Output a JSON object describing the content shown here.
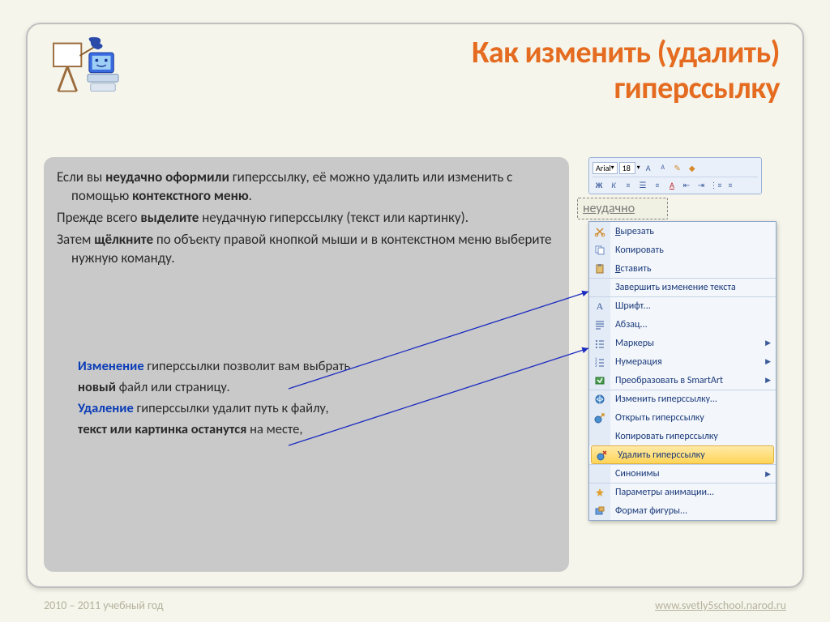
{
  "title_line1": "Как изменить (удалить)",
  "title_line2": "гиперссылку",
  "body": {
    "p1a": "Если вы ",
    "p1b": "неудачно оформили",
    "p1c": " гиперссылку, её можно удалить или изменить с помощью ",
    "p1d": "контекстного меню",
    "p1e": ".",
    "p2a": "Прежде всего ",
    "p2b": "выделите",
    "p2c": " неудачную гиперссылку (текст или картинку).",
    "p3a": "Затем ",
    "p3b": "щёлкните",
    "p3c": " по объекту правой кнопкой мыши и в контекстном меню выберите нужную команду."
  },
  "lower": {
    "l1a": "Изменение",
    "l1b": " гиперссылки позволит вам выбрать ",
    "l2a": "новый",
    "l2b": " файл или страницу.",
    "l3a": "Удаление",
    "l3b": " гиперссылки удалит путь к файлу, ",
    "l4a": "текст или картинка останутся",
    "l4b": " на месте,"
  },
  "toolbar": {
    "font": "Arial",
    "size": "18"
  },
  "selected_word": "неудачно",
  "menu": {
    "cut": "Вырезать",
    "copy": "Копировать",
    "paste": "Вставить",
    "end_edit": "Завершить изменение текста",
    "font": "Шрифт...",
    "paragraph": "Абзац...",
    "bullets": "Маркеры",
    "numbering": "Нумерация",
    "smartart": "Преобразовать в SmartArt",
    "edit_link": "Изменить гиперссылку...",
    "open_link": "Открыть гиперссылку",
    "copy_link": "Копировать гиперссылку",
    "remove_link": "Удалить гиперссылку",
    "synonyms": "Синонимы",
    "anim": "Параметры анимации...",
    "format": "Формат фигуры..."
  },
  "footer": {
    "year": "2010 – 2011 учебный год",
    "url": "www.svetly5school.narod.ru"
  }
}
